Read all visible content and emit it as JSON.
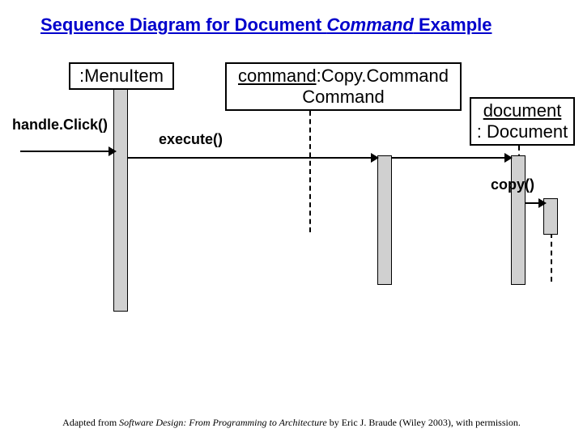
{
  "title": {
    "pre": "Sequence Diagram for Document ",
    "italic": "Command",
    "post": " Example"
  },
  "heads": {
    "menu": ":MenuItem",
    "command_name": "command",
    "command_type": ":Copy.Command Command",
    "document_name": "document",
    "document_type": ": Document"
  },
  "messages": {
    "handleClick": "handle.Click()",
    "execute": "execute()",
    "copy": "copy()"
  },
  "attribution": {
    "pre": "Adapted from ",
    "italic": "Software Design: From Programming to Architecture",
    "post": " by Eric J. Braude (Wiley 2003), with permission."
  },
  "chart_data": [
    {
      "type": "other",
      "diagram_type": "uml_sequence_diagram",
      "title": "Sequence Diagram for Document Command Example",
      "participants": [
        {
          "id": "menu",
          "label": ":MenuItem"
        },
        {
          "id": "command",
          "label": "command:Copy.Command Command"
        },
        {
          "id": "document",
          "label": "document: Document"
        }
      ],
      "messages": [
        {
          "from": "external",
          "to": "menu",
          "label": "handle.Click()",
          "order": 1
        },
        {
          "from": "menu",
          "to": "command",
          "label": "execute()",
          "order": 2
        },
        {
          "from": "command",
          "to": "document",
          "label": "",
          "order": 3
        },
        {
          "from": "document",
          "to": "document",
          "label": "copy()",
          "order": 4
        }
      ]
    }
  ]
}
